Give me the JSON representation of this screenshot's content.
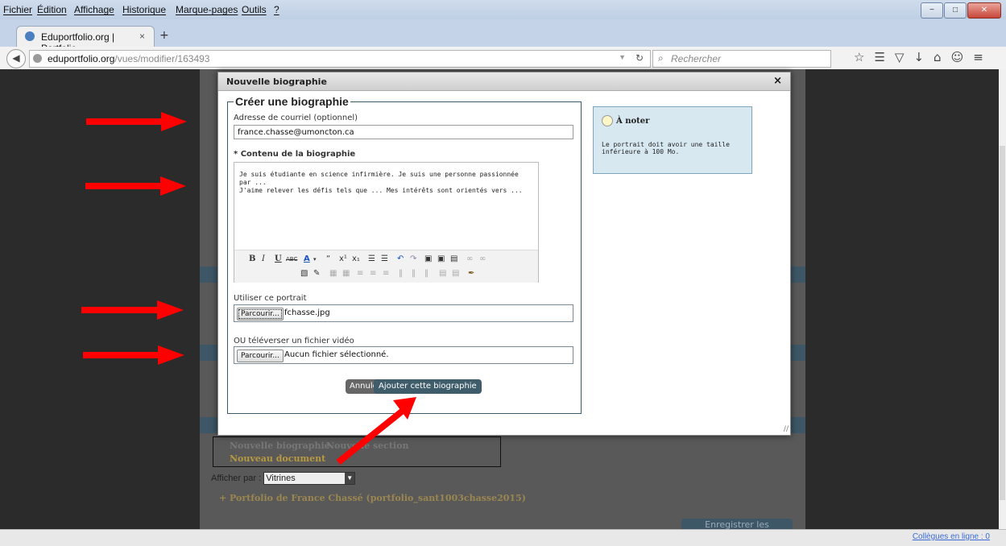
{
  "browser": {
    "menu": [
      "Fichier",
      "Édition",
      "Affichage",
      "Historique",
      "Marque-pages",
      "Outils",
      "?"
    ],
    "tab_title": "Eduportfolio.org | Portfolio...",
    "tab_close": "×",
    "new_tab": "+",
    "url_host": "eduportfolio.org",
    "url_path": "/vues/modifier/163493",
    "search_placeholder": "Rechercher",
    "status_online": "Collègues en ligne : 0"
  },
  "page_bg": {
    "new_bio": "Nouvelle biographie",
    "new_section": "Nouvelle section",
    "new_doc": "Nouveau document",
    "afficher_label": "Afficher par :",
    "afficher_value": "Vitrines",
    "portfolio_link": "+ Portfolio de France Chassé (portfolio_sant1003chasse2015)",
    "save_button": "Enregistrer les modifications"
  },
  "modal": {
    "title": "Nouvelle biographie",
    "close": "×",
    "legend": "Créer une biographie",
    "email_label": "Adresse de courriel (optionnel)",
    "email_value": "france.chasse@umoncton.ca",
    "content_label": "* Contenu de la biographie",
    "content_text": "Je suis étudiante en science infirmière. Je suis une personne passionnée par ...\nJ'aime relever les défis tels que ... Mes intérêts sont orientés vers ...",
    "portrait_label": "Utiliser ce portrait",
    "browse": "Parcourir...",
    "portrait_file": "fchasse.jpg",
    "video_label": "OU téléverser un fichier vidéo",
    "video_file": "Aucun fichier sélectionné.",
    "cancel": "Annuler",
    "submit": "Ajouter cette biographie",
    "note_title": "À noter",
    "note_text": "Le portrait doit avoir une taille inférieure à 100 Mo."
  },
  "colors": {
    "accent": "#3f5c6b",
    "arrow": "#ff0000",
    "note_bg": "#d7e8f1"
  }
}
